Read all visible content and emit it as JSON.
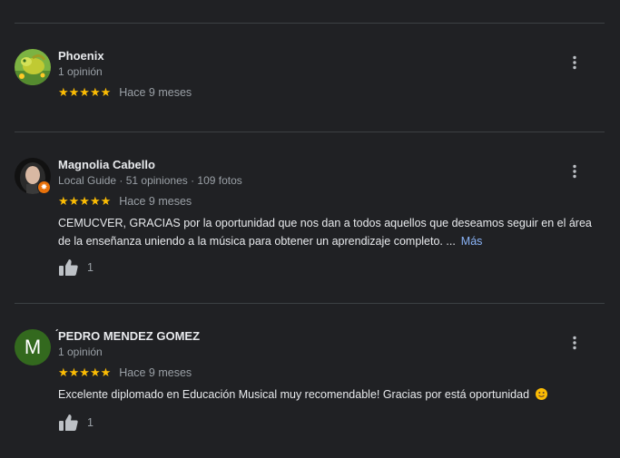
{
  "reviews": [
    {
      "name": "Phoenix",
      "meta": "1 opinión",
      "stars": "★★★★★",
      "date": "Hace 9 meses"
    },
    {
      "name": "Magnolia Cabello",
      "meta": "Local Guide · 51 opiniones · 109 fotos",
      "stars": "★★★★★",
      "date": "Hace 9 meses",
      "text": "CEMUCVER, GRACIAS por la oportunidad que nos dan a todos aquellos que deseamos seguir en el área de la enseñanza uniendo a la música para obtener un aprendizaje completo. ...",
      "more_label": "Más",
      "likes": "1"
    },
    {
      "name": "́PEDRO MENDEZ GOMEZ",
      "avatar_letter": "M",
      "meta": "1 opinión",
      "stars": "★★★★★",
      "date": "Hace 9 meses",
      "text": "Excelente diplomado en Educación Musical muy recomendable! Gracias por está oportunidad",
      "likes": "1"
    }
  ],
  "icons": {
    "star": "star-icon",
    "more": "more-vert-icon",
    "like": "thumb-up-icon",
    "emoji": "smiling-face-emoji"
  },
  "colors": {
    "background": "#202124",
    "star": "#fbbc04",
    "link": "#8ab4f8",
    "secondary_text": "#9aa0a6",
    "local_guide_badge": "#e8710a",
    "avatar_m": "#33691e"
  }
}
